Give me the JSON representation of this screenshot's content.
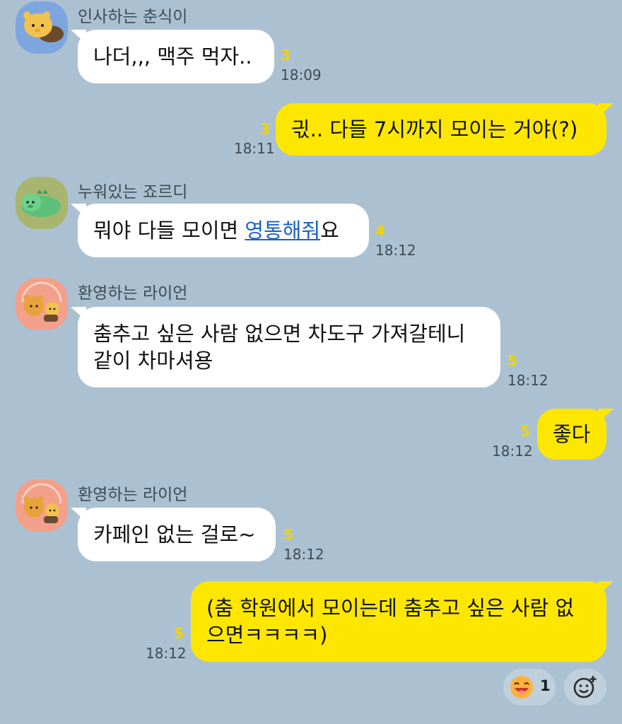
{
  "messages": [
    {
      "sender": "인사하는 춘식이",
      "lines": [
        "나더,,, 맥주 먹자.."
      ],
      "unread": "3",
      "time": "18:09"
    },
    {
      "lines": [
        "긗.. 다들 7시까지 모이는 거야(?)"
      ],
      "unread": "3",
      "time": "18:11"
    },
    {
      "sender": "누워있는 죠르디",
      "text_before": "뭐야 다들 모이면 ",
      "link_text": "영통해줘",
      "text_after": "요",
      "unread": "4",
      "time": "18:12"
    },
    {
      "sender": "환영하는 라이언",
      "lines": [
        "춤추고 싶은 사람 없으면 차도구 가져갈테니",
        "같이 차마셔용"
      ],
      "unread": "5",
      "time": "18:12"
    },
    {
      "lines": [
        "좋다"
      ],
      "unread": "5",
      "time": "18:12"
    },
    {
      "sender": "환영하는 라이언",
      "lines": [
        "카페인 없는 걸로~"
      ],
      "unread": "5",
      "time": "18:12"
    },
    {
      "lines": [
        "(춤 학원에서 모이는데 춤추고 싶은 사람 없",
        "으면ㅋㅋㅋㅋ)"
      ],
      "unread": "5",
      "time": "18:12"
    }
  ],
  "reaction": {
    "icon": "laughing-face-icon",
    "count": "1"
  },
  "add_reaction_icon": "add-emoji-icon",
  "colors": {
    "background": "#abc1d1",
    "sent_bubble": "#fde700",
    "received_bubble": "#ffffff",
    "unread": "#f2d300",
    "link": "#1a62c7"
  }
}
